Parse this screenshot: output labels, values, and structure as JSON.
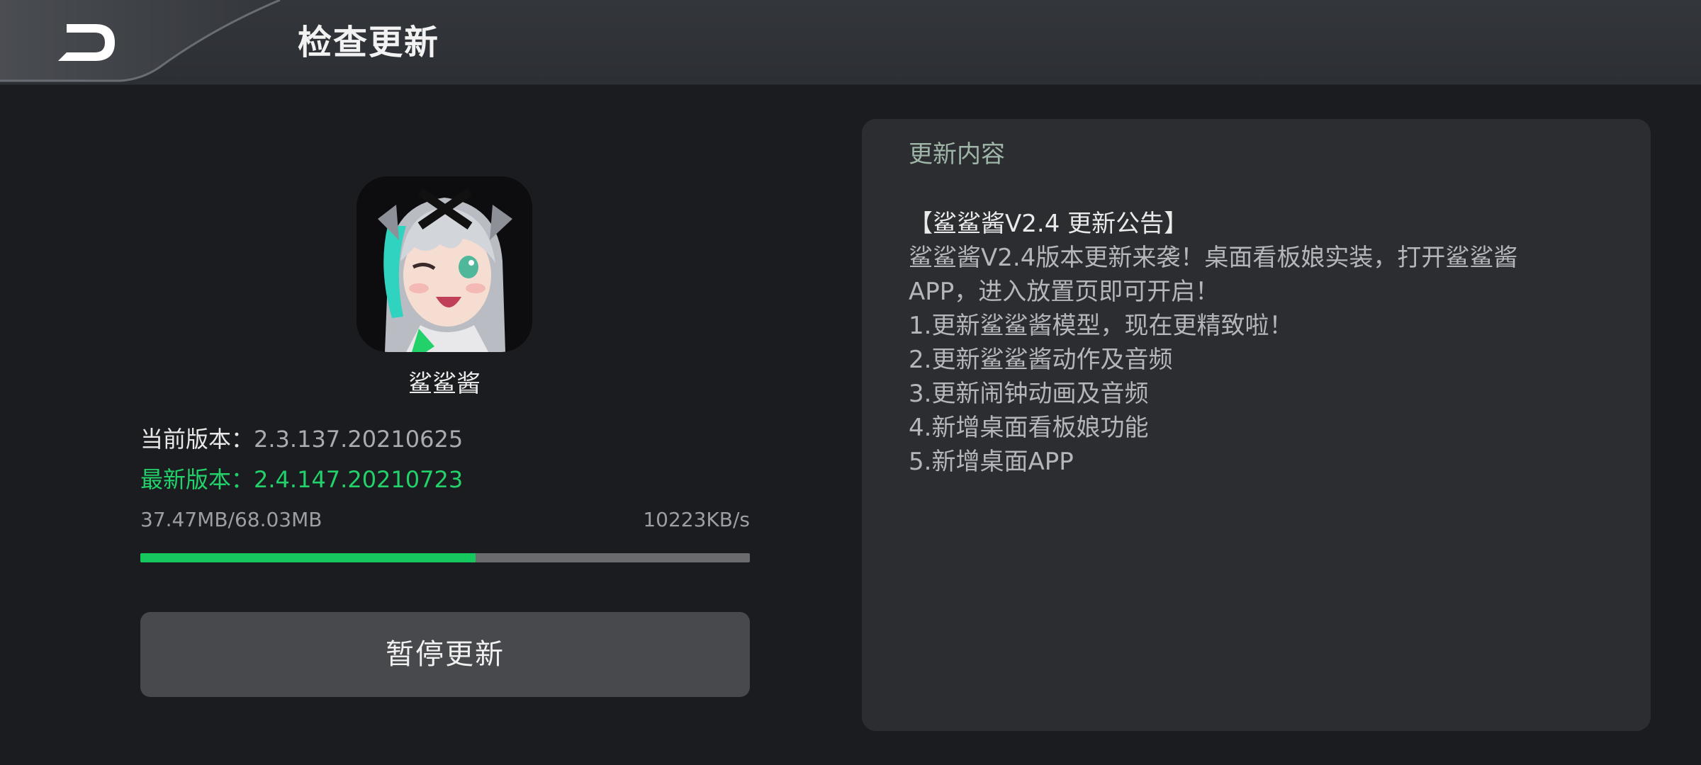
{
  "header": {
    "title": "检查更新",
    "back_icon": "back-arrow-icon"
  },
  "app": {
    "name": "鲨鲨酱",
    "icon": "anime-character-app-icon"
  },
  "versions": {
    "current_label": "当前版本：",
    "current_value": "2.3.137.20210625",
    "latest_label": "最新版本：",
    "latest_value": "2.4.147.20210723"
  },
  "download": {
    "size_text": "37.47MB/68.03MB",
    "speed_text": "10223KB/s",
    "progress_fraction": 0.55,
    "progress_color": "#16c75e"
  },
  "actions": {
    "pause_label": "暂停更新"
  },
  "notes": {
    "header": "更新内容",
    "lines": [
      "【鲨鲨酱V2.4 更新公告】",
      "鲨鲨酱V2.4版本更新来袭！桌面看板娘实装，打开鲨鲨酱",
      "APP，进入放置页即可开启！",
      "1.更新鲨鲨酱模型，现在更精致啦！",
      "2.更新鲨鲨酱动作及音频",
      "3.更新闹钟动画及音频",
      "4.新增桌面看板娘功能",
      "5.新增桌面APP"
    ]
  },
  "colors": {
    "accent_green": "#22d16a",
    "background": "#1b1c1f",
    "panel": "#2b2d31"
  }
}
